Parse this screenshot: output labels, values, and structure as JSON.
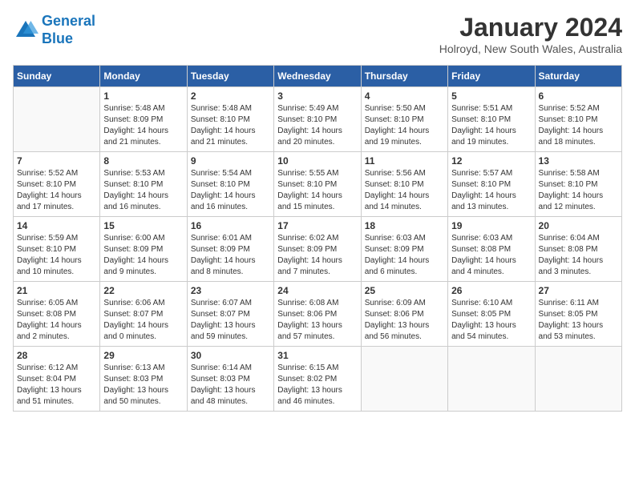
{
  "logo": {
    "line1": "General",
    "line2": "Blue"
  },
  "title": "January 2024",
  "subtitle": "Holroyd, New South Wales, Australia",
  "days_of_week": [
    "Sunday",
    "Monday",
    "Tuesday",
    "Wednesday",
    "Thursday",
    "Friday",
    "Saturday"
  ],
  "weeks": [
    [
      {
        "day": "",
        "info": ""
      },
      {
        "day": "1",
        "info": "Sunrise: 5:48 AM\nSunset: 8:09 PM\nDaylight: 14 hours\nand 21 minutes."
      },
      {
        "day": "2",
        "info": "Sunrise: 5:48 AM\nSunset: 8:10 PM\nDaylight: 14 hours\nand 21 minutes."
      },
      {
        "day": "3",
        "info": "Sunrise: 5:49 AM\nSunset: 8:10 PM\nDaylight: 14 hours\nand 20 minutes."
      },
      {
        "day": "4",
        "info": "Sunrise: 5:50 AM\nSunset: 8:10 PM\nDaylight: 14 hours\nand 19 minutes."
      },
      {
        "day": "5",
        "info": "Sunrise: 5:51 AM\nSunset: 8:10 PM\nDaylight: 14 hours\nand 19 minutes."
      },
      {
        "day": "6",
        "info": "Sunrise: 5:52 AM\nSunset: 8:10 PM\nDaylight: 14 hours\nand 18 minutes."
      }
    ],
    [
      {
        "day": "7",
        "info": "Sunrise: 5:52 AM\nSunset: 8:10 PM\nDaylight: 14 hours\nand 17 minutes."
      },
      {
        "day": "8",
        "info": "Sunrise: 5:53 AM\nSunset: 8:10 PM\nDaylight: 14 hours\nand 16 minutes."
      },
      {
        "day": "9",
        "info": "Sunrise: 5:54 AM\nSunset: 8:10 PM\nDaylight: 14 hours\nand 16 minutes."
      },
      {
        "day": "10",
        "info": "Sunrise: 5:55 AM\nSunset: 8:10 PM\nDaylight: 14 hours\nand 15 minutes."
      },
      {
        "day": "11",
        "info": "Sunrise: 5:56 AM\nSunset: 8:10 PM\nDaylight: 14 hours\nand 14 minutes."
      },
      {
        "day": "12",
        "info": "Sunrise: 5:57 AM\nSunset: 8:10 PM\nDaylight: 14 hours\nand 13 minutes."
      },
      {
        "day": "13",
        "info": "Sunrise: 5:58 AM\nSunset: 8:10 PM\nDaylight: 14 hours\nand 12 minutes."
      }
    ],
    [
      {
        "day": "14",
        "info": "Sunrise: 5:59 AM\nSunset: 8:10 PM\nDaylight: 14 hours\nand 10 minutes."
      },
      {
        "day": "15",
        "info": "Sunrise: 6:00 AM\nSunset: 8:09 PM\nDaylight: 14 hours\nand 9 minutes."
      },
      {
        "day": "16",
        "info": "Sunrise: 6:01 AM\nSunset: 8:09 PM\nDaylight: 14 hours\nand 8 minutes."
      },
      {
        "day": "17",
        "info": "Sunrise: 6:02 AM\nSunset: 8:09 PM\nDaylight: 14 hours\nand 7 minutes."
      },
      {
        "day": "18",
        "info": "Sunrise: 6:03 AM\nSunset: 8:09 PM\nDaylight: 14 hours\nand 6 minutes."
      },
      {
        "day": "19",
        "info": "Sunrise: 6:03 AM\nSunset: 8:08 PM\nDaylight: 14 hours\nand 4 minutes."
      },
      {
        "day": "20",
        "info": "Sunrise: 6:04 AM\nSunset: 8:08 PM\nDaylight: 14 hours\nand 3 minutes."
      }
    ],
    [
      {
        "day": "21",
        "info": "Sunrise: 6:05 AM\nSunset: 8:08 PM\nDaylight: 14 hours\nand 2 minutes."
      },
      {
        "day": "22",
        "info": "Sunrise: 6:06 AM\nSunset: 8:07 PM\nDaylight: 14 hours\nand 0 minutes."
      },
      {
        "day": "23",
        "info": "Sunrise: 6:07 AM\nSunset: 8:07 PM\nDaylight: 13 hours\nand 59 minutes."
      },
      {
        "day": "24",
        "info": "Sunrise: 6:08 AM\nSunset: 8:06 PM\nDaylight: 13 hours\nand 57 minutes."
      },
      {
        "day": "25",
        "info": "Sunrise: 6:09 AM\nSunset: 8:06 PM\nDaylight: 13 hours\nand 56 minutes."
      },
      {
        "day": "26",
        "info": "Sunrise: 6:10 AM\nSunset: 8:05 PM\nDaylight: 13 hours\nand 54 minutes."
      },
      {
        "day": "27",
        "info": "Sunrise: 6:11 AM\nSunset: 8:05 PM\nDaylight: 13 hours\nand 53 minutes."
      }
    ],
    [
      {
        "day": "28",
        "info": "Sunrise: 6:12 AM\nSunset: 8:04 PM\nDaylight: 13 hours\nand 51 minutes."
      },
      {
        "day": "29",
        "info": "Sunrise: 6:13 AM\nSunset: 8:03 PM\nDaylight: 13 hours\nand 50 minutes."
      },
      {
        "day": "30",
        "info": "Sunrise: 6:14 AM\nSunset: 8:03 PM\nDaylight: 13 hours\nand 48 minutes."
      },
      {
        "day": "31",
        "info": "Sunrise: 6:15 AM\nSunset: 8:02 PM\nDaylight: 13 hours\nand 46 minutes."
      },
      {
        "day": "",
        "info": ""
      },
      {
        "day": "",
        "info": ""
      },
      {
        "day": "",
        "info": ""
      }
    ]
  ]
}
